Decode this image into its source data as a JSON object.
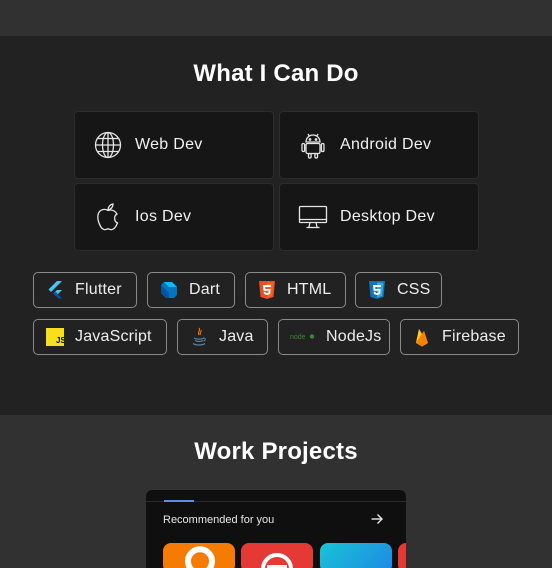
{
  "skills_section": {
    "title": "What I Can Do",
    "services": [
      {
        "label": "Web Dev",
        "icon": "globe-icon"
      },
      {
        "label": "Android Dev",
        "icon": "android-icon"
      },
      {
        "label": "Ios Dev",
        "icon": "apple-icon"
      },
      {
        "label": "Desktop Dev",
        "icon": "monitor-icon"
      }
    ],
    "technologies": [
      {
        "label": "Flutter",
        "icon": "flutter-icon"
      },
      {
        "label": "Dart",
        "icon": "dart-icon"
      },
      {
        "label": "HTML",
        "icon": "html5-icon"
      },
      {
        "label": "CSS",
        "icon": "css3-icon"
      },
      {
        "label": "JavaScript",
        "icon": "javascript-icon"
      },
      {
        "label": "Java",
        "icon": "java-icon"
      },
      {
        "label": "NodeJs",
        "icon": "nodejs-icon"
      },
      {
        "label": "Firebase",
        "icon": "firebase-icon"
      }
    ]
  },
  "projects_section": {
    "title": "Work Projects",
    "preview": {
      "heading": "Recommended for you"
    }
  },
  "colors": {
    "page_bg": "#313131",
    "section_bg": "#222222",
    "card_bg": "#161616",
    "chip_border": "#8a8a8a"
  }
}
